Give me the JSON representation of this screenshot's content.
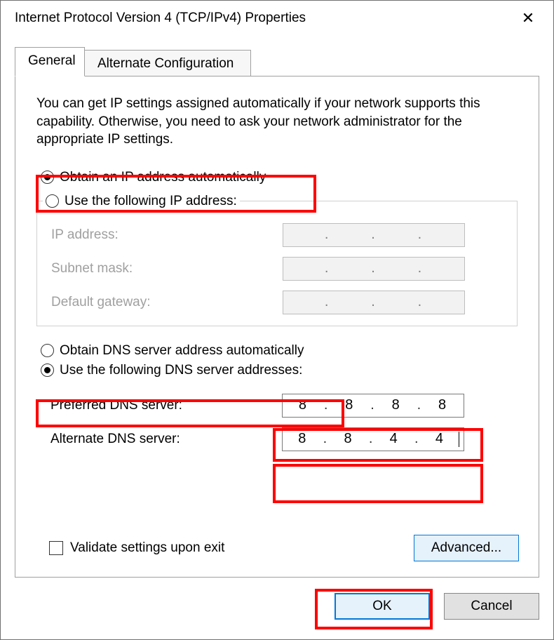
{
  "window": {
    "title": "Internet Protocol Version 4 (TCP/IPv4) Properties"
  },
  "tabs": [
    {
      "label": "General",
      "active": true
    },
    {
      "label": "Alternate Configuration",
      "active": false
    }
  ],
  "intro_text": "You can get IP settings assigned automatically if your network supports this capability. Otherwise, you need to ask your network administrator for the appropriate IP settings.",
  "ip_section": {
    "radio_auto": {
      "label": "Obtain an IP address automatically",
      "checked": true
    },
    "radio_manual": {
      "label": "Use the following IP address:",
      "checked": false
    },
    "fields": {
      "ip_address": {
        "label": "IP address:",
        "value": [
          "",
          "",
          "",
          ""
        ],
        "enabled": false
      },
      "subnet_mask": {
        "label": "Subnet mask:",
        "value": [
          "",
          "",
          "",
          ""
        ],
        "enabled": false
      },
      "gateway": {
        "label": "Default gateway:",
        "value": [
          "",
          "",
          "",
          ""
        ],
        "enabled": false
      }
    }
  },
  "dns_section": {
    "radio_auto": {
      "label": "Obtain DNS server address automatically",
      "checked": false
    },
    "radio_manual": {
      "label": "Use the following DNS server addresses:",
      "checked": true
    },
    "fields": {
      "preferred": {
        "label": "Preferred DNS server:",
        "value": [
          "8",
          "8",
          "8",
          "8"
        ],
        "enabled": true
      },
      "alternate": {
        "label": "Alternate DNS server:",
        "value": [
          "8",
          "8",
          "4",
          "4"
        ],
        "enabled": true
      }
    }
  },
  "validate_checkbox": {
    "label": "Validate settings upon exit",
    "checked": false
  },
  "buttons": {
    "advanced": "Advanced...",
    "ok": "OK",
    "cancel": "Cancel"
  }
}
